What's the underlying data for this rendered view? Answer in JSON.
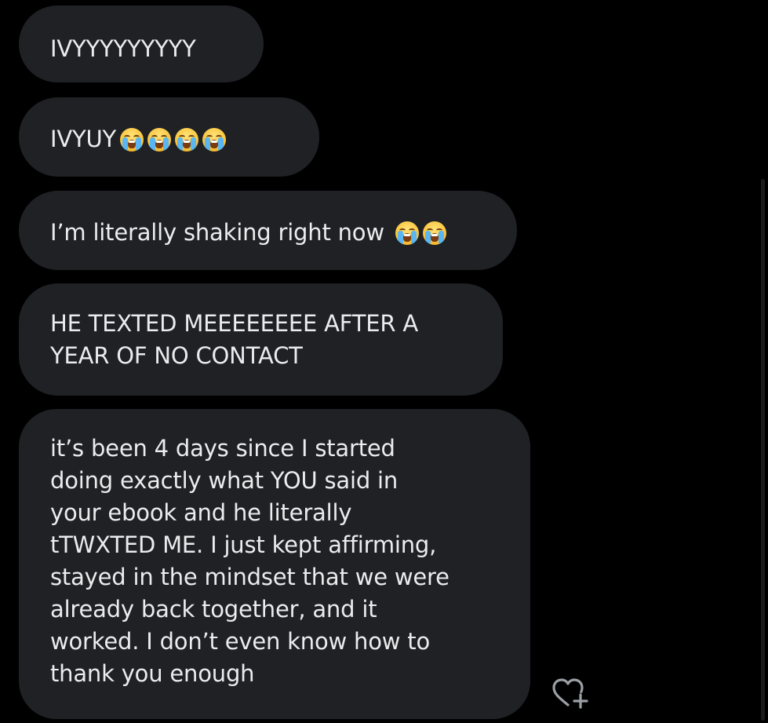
{
  "messages": [
    {
      "text": "IVYYYYYYYYY",
      "emoji_icon": "loudly-crying-face-icon",
      "emoji_count": 0
    },
    {
      "text": "IVYUY",
      "emoji_icon": "loudly-crying-face-icon",
      "emoji_count": 4
    },
    {
      "text": "I’m literally shaking right now ",
      "emoji_icon": "loudly-crying-face-icon",
      "emoji_count": 2
    },
    {
      "text": "HE TEXTED MEEEEEEEE AFTER A\nYEAR OF NO CONTACT"
    },
    {
      "text": "it’s been 4 days since I started\ndoing exactly what YOU said in\nyour ebook and he literally\ntTWXTED ME. I just kept affirming,\nstayed in the mindset that we were\nalready back together, and it\nworked. I don’t even know how to\nthank you enough"
    }
  ],
  "actions": {
    "react_icon": "heart-plus-icon"
  },
  "colors": {
    "background": "#000000",
    "bubble": "#1f2125",
    "text": "#ebeced",
    "icon": "#9aa0a6"
  }
}
